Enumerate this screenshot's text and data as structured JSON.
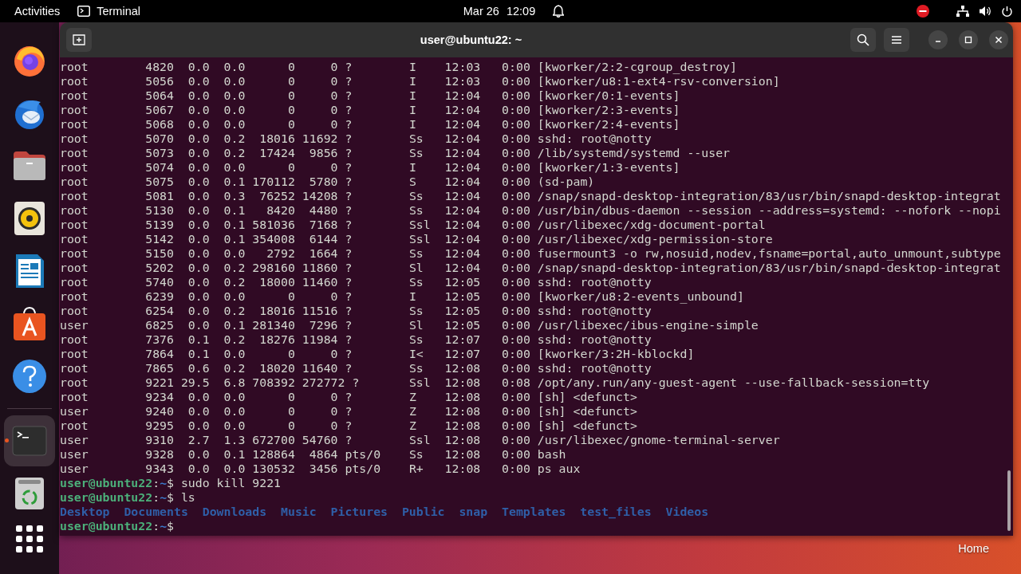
{
  "top_bar": {
    "activities": "Activities",
    "app_name": "Terminal",
    "date": "Mar 26",
    "time": "12:09"
  },
  "dock": {
    "items": [
      {
        "running": false
      },
      {
        "running": false
      },
      {
        "running": false
      },
      {
        "running": false
      },
      {
        "running": false
      },
      {
        "running": false
      },
      {
        "running": false
      },
      {
        "running": true
      },
      {
        "running": false
      }
    ]
  },
  "window": {
    "title": "user@ubuntu22: ~"
  },
  "terminal": {
    "lines": [
      {
        "kind": "output",
        "text": "root        4820  0.0  0.0      0     0 ?        I    12:03   0:00 [kworker/2:2-cgroup_destroy]"
      },
      {
        "kind": "output",
        "text": "root        5056  0.0  0.0      0     0 ?        I    12:03   0:00 [kworker/u8:1-ext4-rsv-conversion]"
      },
      {
        "kind": "output",
        "text": "root        5064  0.0  0.0      0     0 ?        I    12:04   0:00 [kworker/0:1-events]"
      },
      {
        "kind": "output",
        "text": "root        5067  0.0  0.0      0     0 ?        I    12:04   0:00 [kworker/2:3-events]"
      },
      {
        "kind": "output",
        "text": "root        5068  0.0  0.0      0     0 ?        I    12:04   0:00 [kworker/2:4-events]"
      },
      {
        "kind": "output",
        "text": "root        5070  0.0  0.2  18016 11692 ?        Ss   12:04   0:00 sshd: root@notty"
      },
      {
        "kind": "output",
        "text": "root        5073  0.0  0.2  17424  9856 ?        Ss   12:04   0:00 /lib/systemd/systemd --user"
      },
      {
        "kind": "output",
        "text": "root        5074  0.0  0.0      0     0 ?        I    12:04   0:00 [kworker/1:3-events]"
      },
      {
        "kind": "output",
        "text": "root        5075  0.0  0.1 170112  5780 ?        S    12:04   0:00 (sd-pam)"
      },
      {
        "kind": "output",
        "text": "root        5081  0.0  0.3  76252 14208 ?        Ss   12:04   0:00 /snap/snapd-desktop-integration/83/usr/bin/snapd-desktop-integrat"
      },
      {
        "kind": "output",
        "text": "root        5130  0.0  0.1   8420  4480 ?        Ss   12:04   0:00 /usr/bin/dbus-daemon --session --address=systemd: --nofork --nopi"
      },
      {
        "kind": "output",
        "text": "root        5139  0.0  0.1 581036  7168 ?        Ssl  12:04   0:00 /usr/libexec/xdg-document-portal"
      },
      {
        "kind": "output",
        "text": "root        5142  0.0  0.1 354008  6144 ?        Ssl  12:04   0:00 /usr/libexec/xdg-permission-store"
      },
      {
        "kind": "output",
        "text": "root        5150  0.0  0.0   2792  1664 ?        Ss   12:04   0:00 fusermount3 -o rw,nosuid,nodev,fsname=portal,auto_unmount,subtype"
      },
      {
        "kind": "output",
        "text": "root        5202  0.0  0.2 298160 11860 ?        Sl   12:04   0:00 /snap/snapd-desktop-integration/83/usr/bin/snapd-desktop-integrat"
      },
      {
        "kind": "output",
        "text": "root        5740  0.0  0.2  18000 11460 ?        Ss   12:05   0:00 sshd: root@notty"
      },
      {
        "kind": "output",
        "text": "root        6239  0.0  0.0      0     0 ?        I    12:05   0:00 [kworker/u8:2-events_unbound]"
      },
      {
        "kind": "output",
        "text": "root        6254  0.0  0.2  18016 11516 ?        Ss   12:05   0:00 sshd: root@notty"
      },
      {
        "kind": "output",
        "text": "user        6825  0.0  0.1 281340  7296 ?        Sl   12:05   0:00 /usr/libexec/ibus-engine-simple"
      },
      {
        "kind": "output",
        "text": "root        7376  0.1  0.2  18276 11984 ?        Ss   12:07   0:00 sshd: root@notty"
      },
      {
        "kind": "output",
        "text": "root        7864  0.1  0.0      0     0 ?        I<   12:07   0:00 [kworker/3:2H-kblockd]"
      },
      {
        "kind": "output",
        "text": "root        7865  0.6  0.2  18020 11640 ?        Ss   12:08   0:00 sshd: root@notty"
      },
      {
        "kind": "output",
        "text": "root        9221 29.5  6.8 708392 272772 ?       Ssl  12:08   0:08 /opt/any.run/any-guest-agent --use-fallback-session=tty"
      },
      {
        "kind": "output",
        "text": "root        9234  0.0  0.0      0     0 ?        Z    12:08   0:00 [sh] <defunct>"
      },
      {
        "kind": "output",
        "text": "user        9240  0.0  0.0      0     0 ?        Z    12:08   0:00 [sh] <defunct>"
      },
      {
        "kind": "output",
        "text": "root        9295  0.0  0.0      0     0 ?        Z    12:08   0:00 [sh] <defunct>"
      },
      {
        "kind": "output",
        "text": "user        9310  2.7  1.3 672700 54760 ?        Ssl  12:08   0:00 /usr/libexec/gnome-terminal-server"
      },
      {
        "kind": "output",
        "text": "user        9328  0.0  0.1 128864  4864 pts/0    Ss   12:08   0:00 bash"
      },
      {
        "kind": "output",
        "text": "user        9343  0.0  0.0 130532  3456 pts/0    R+   12:08   0:00 ps aux"
      },
      {
        "kind": "prompt",
        "user_host": "user@ubuntu22",
        "separator": ":",
        "path": "~",
        "symbol": "$",
        "command": "sudo kill 9221"
      },
      {
        "kind": "prompt",
        "user_host": "user@ubuntu22",
        "separator": ":",
        "path": "~",
        "symbol": "$",
        "command": "ls"
      },
      {
        "kind": "listing",
        "entries": [
          "Desktop",
          "Documents",
          "Downloads",
          "Music",
          "Pictures",
          "Public",
          "snap",
          "Templates",
          "test_files",
          "Videos"
        ]
      },
      {
        "kind": "prompt",
        "user_host": "user@ubuntu22",
        "separator": ":",
        "path": "~",
        "symbol": "$"
      }
    ]
  },
  "desktop": {
    "icons": [
      {
        "label": "Home"
      }
    ]
  }
}
